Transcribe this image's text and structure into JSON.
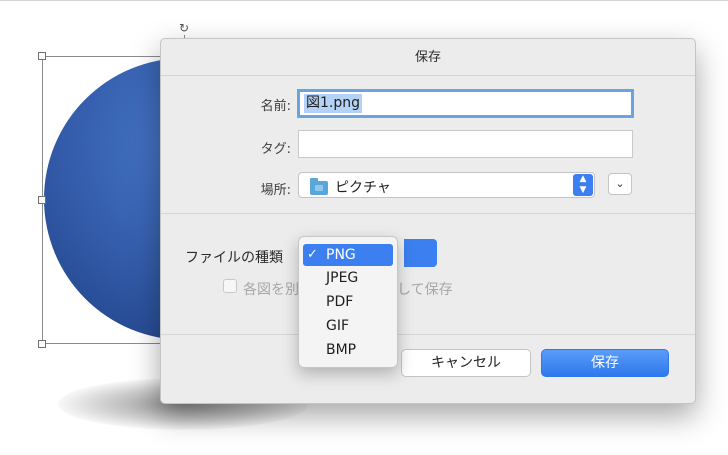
{
  "dialog": {
    "title": "保存",
    "name_label": "名前:",
    "name_value": "図1.png",
    "tags_label": "タグ:",
    "tags_value": "",
    "location_label": "場所:",
    "location_value": "ピクチャ",
    "format_label": "ファイルの種類",
    "save_each_label": "各図を別",
    "save_each_label_tail": "として保存",
    "cancel_label": "キャンセル",
    "save_label": "保存"
  },
  "format_menu": {
    "check_mark": "✓",
    "items": [
      {
        "label": "PNG",
        "selected": true
      },
      {
        "label": "JPEG",
        "selected": false
      },
      {
        "label": "PDF",
        "selected": false
      },
      {
        "label": "GIF",
        "selected": false
      },
      {
        "label": "BMP",
        "selected": false
      }
    ]
  },
  "icons": {
    "rotate": "rotate-handle-icon",
    "folder": "folder-icon",
    "stepper": "up-down-stepper-icon",
    "disclose": "chevron-down-icon"
  },
  "colors": {
    "accent": "#3b7ff0",
    "shape_fill": "#2e5aa8"
  }
}
